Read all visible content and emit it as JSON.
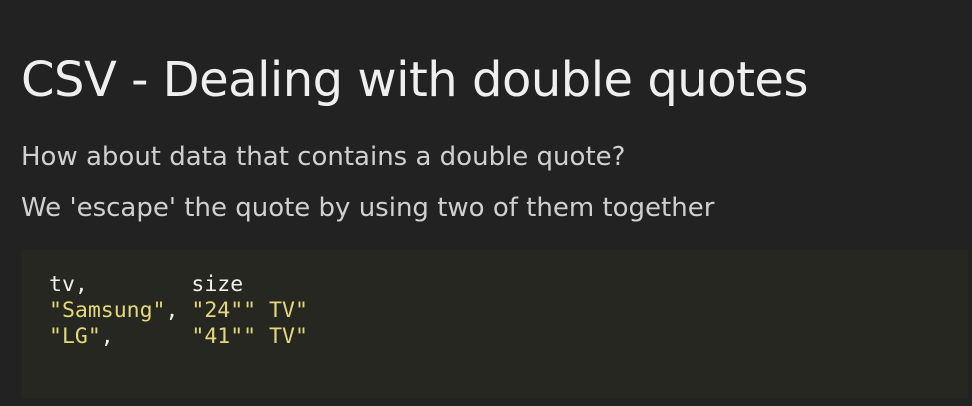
{
  "slide": {
    "title": "CSV - Dealing with double quotes",
    "paragraphs": [
      "How about data that contains a double quote?",
      "We 'escape' the quote by using two of them together"
    ],
    "code": {
      "lines": [
        [
          {
            "text": "tv,        size",
            "kind": "plain"
          }
        ],
        [
          {
            "text": "\"Samsung\"",
            "kind": "string"
          },
          {
            "text": ", ",
            "kind": "plain"
          },
          {
            "text": "\"24\"\" TV\"",
            "kind": "string"
          }
        ],
        [
          {
            "text": "\"LG\"",
            "kind": "string"
          },
          {
            "text": ",      ",
            "kind": "plain"
          },
          {
            "text": "\"41\"\" TV\"",
            "kind": "string"
          }
        ]
      ]
    },
    "colors": {
      "background": "#222222",
      "code_background": "#272722",
      "code_string": "#e3d97a",
      "code_plain": "#f1f1ea",
      "title": "#efefef",
      "body_text": "#d0d0d0"
    }
  }
}
